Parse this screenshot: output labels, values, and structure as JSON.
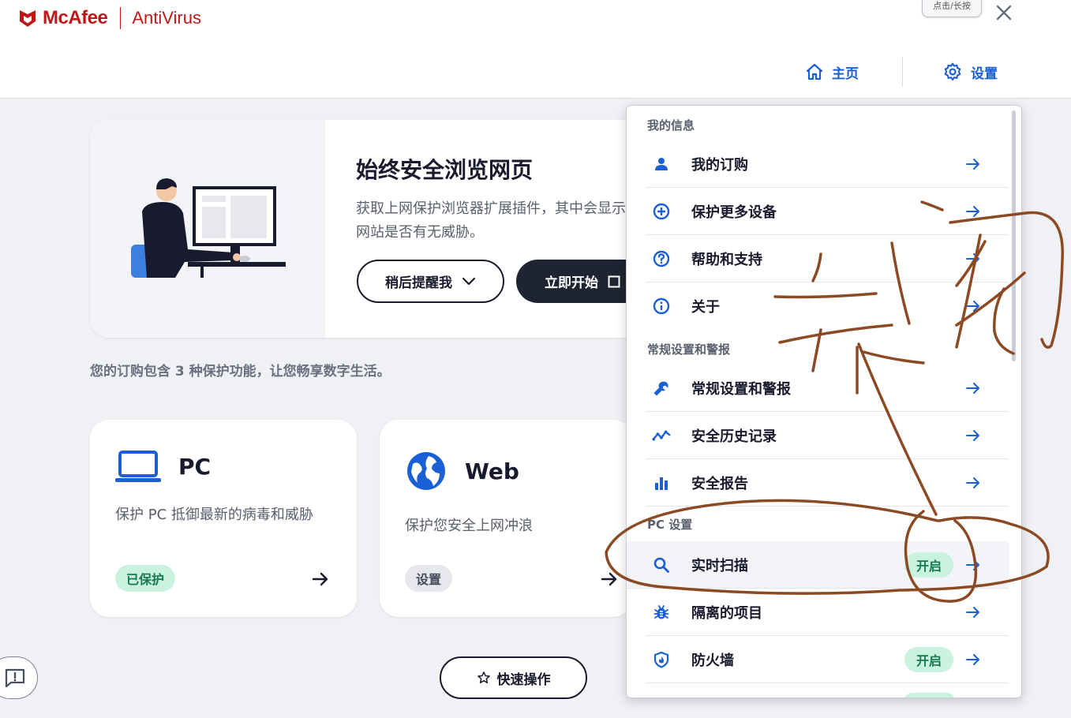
{
  "app": {
    "brand": "McAfee",
    "product": "AntiVirus",
    "tooltip_chip": "点击/长按",
    "colors": {
      "brand": "#c01818",
      "accent": "#1a5fd6",
      "dark": "#1f2433",
      "success_bg": "#c9f2e1",
      "success_text": "#137a4e",
      "annotation_ink": "#8b4a24"
    }
  },
  "nav": {
    "home_label": "主页",
    "settings_label": "设置"
  },
  "promo": {
    "title": "始终安全浏览网页",
    "description": "获取上网保护浏览器扩展插件，其中会显示网站是否有无威胁。",
    "later_button": "稍后提醒我",
    "start_button": "立即开始"
  },
  "subscription_text": "您的订购包含 3 种保护功能，让您畅享数字生活。",
  "cards": {
    "pc": {
      "title": "PC",
      "description": "保护 PC 抵御最新的病毒和威胁",
      "badge": "已保护",
      "icon": "laptop-icon"
    },
    "web": {
      "title": "Web",
      "description": "保护您安全上网冲浪",
      "badge": "设置",
      "icon": "globe-icon"
    }
  },
  "quick_actions_label": "快速操作",
  "settings_menu": {
    "sections": [
      {
        "header": "我的信息",
        "items": [
          {
            "label": "我的订购",
            "icon": "person-icon"
          },
          {
            "label": "保护更多设备",
            "icon": "plus-circle-icon"
          },
          {
            "label": "帮助和支持",
            "icon": "help-icon"
          },
          {
            "label": "关于",
            "icon": "info-icon"
          }
        ]
      },
      {
        "header": "常规设置和警报",
        "items": [
          {
            "label": "常规设置和警报",
            "icon": "wrench-icon"
          },
          {
            "label": "安全历史记录",
            "icon": "activity-icon"
          },
          {
            "label": "安全报告",
            "icon": "bar-chart-icon"
          }
        ]
      },
      {
        "header": "PC 设置",
        "items": [
          {
            "label": "实时扫描",
            "icon": "search-icon",
            "status": "开启",
            "highlighted": true
          },
          {
            "label": "隔离的项目",
            "icon": "bug-icon"
          },
          {
            "label": "防火墙",
            "icon": "shield-flame-icon",
            "status": "开启"
          }
        ]
      }
    ]
  }
}
